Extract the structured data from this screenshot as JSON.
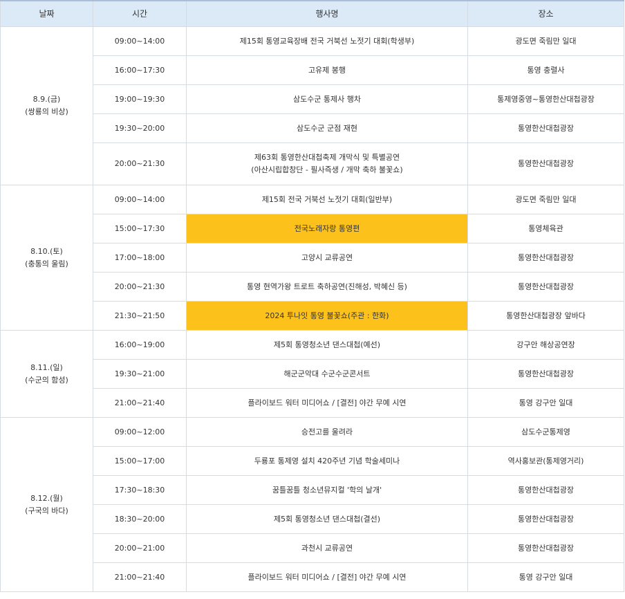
{
  "header": {
    "date": "날짜",
    "time": "시간",
    "event": "행사명",
    "place": "장소"
  },
  "highlight_color": "#fcc21b",
  "days": [
    {
      "date": "8.9.(금)",
      "subtitle": "(쌍룡의 비상)",
      "rows": [
        {
          "time": "09:00~14:00",
          "event": "제15회 통영교육장배 전국 거북선 노젓기 대회(학생부)",
          "place": "광도면 죽림만 일대"
        },
        {
          "time": "16:00~17:30",
          "event": "고유제 봉행",
          "place": "통영 충렬사"
        },
        {
          "time": "19:00~19:30",
          "event": "삼도수군 통제사 행차",
          "place": "통제영중영~통영한산대첩광장"
        },
        {
          "time": "19:30~20:00",
          "event": "삼도수군 군점 재현",
          "place": "통영한산대첩광장"
        },
        {
          "time": "20:00~21:30",
          "event": "제63회 통영한산대첩축제 개막식 및 특별공연",
          "event2": "(아산시립합창단 - 필사즉생 / 개막 축하 불꽃쇼)",
          "place": "통영한산대첩광장"
        }
      ]
    },
    {
      "date": "8.10.(토)",
      "subtitle": "(충통의 울림)",
      "rows": [
        {
          "time": "09:00~14:00",
          "event": "제15회 전국 거북선 노젓기 대회(일반부)",
          "place": "광도면 죽림만 일대"
        },
        {
          "time": "15:00~17:30",
          "event": "전국노래자랑 통영편",
          "place": "통영체육관"
        },
        {
          "time": "17:00~18:00",
          "event": "고양시 교류공연",
          "place": "통영한산대첩광장"
        },
        {
          "time": "20:00~21:30",
          "event": "통영 현역가왕 트로트 축하공연(진해성, 박혜신 등)",
          "place": "통영한산대첩광장"
        },
        {
          "time": "21:30~21:50",
          "event": "2024 투나잇 통영 불꽃쇼(주관 : 한화)",
          "place": "통영한산대첩광장 앞바다"
        }
      ]
    },
    {
      "date": "8.11.(일)",
      "subtitle": "(수군의 함성)",
      "rows": [
        {
          "time": "16:00~19:00",
          "event": "제5회 통영청소년 댄스대첩(예선)",
          "place": "강구안 해상공연장"
        },
        {
          "time": "19:30~21:00",
          "event": "해군군악대 수군수군콘서트",
          "place": "통영한산대첩광장"
        },
        {
          "time": "21:00~21:40",
          "event": "플라이보드 워터 미디어쇼 / [결전] 야간 무예 시연",
          "place": "통영 강구안 일대"
        }
      ]
    },
    {
      "date": "8.12.(월)",
      "subtitle": "(구국의 바다)",
      "rows": [
        {
          "time": "09:00~12:00",
          "event": "승전고를 울려라",
          "place": "삼도수군통제영"
        },
        {
          "time": "15:00~17:00",
          "event": "두룡포 통제영 설치 420주년 기념 학술세미나",
          "place": "역사홍보관(통제영거리)"
        },
        {
          "time": "17:30~18:30",
          "event": "꿈틀꿈틀 청소년뮤지컬 '학의 날개'",
          "place": "통영한산대첩광장"
        },
        {
          "time": "18:30~20:00",
          "event": "제5회 통영청소년 댄스대첩(결선)",
          "place": "통영한산대첩광장"
        },
        {
          "time": "20:00~21:00",
          "event": "과천시 교류공연",
          "place": "통영한산대첩광장"
        },
        {
          "time": "21:00~21:40",
          "event": "플라이보드 워터 미디어쇼 / [결전] 야간 무예 시연",
          "place": "통영 강구안 일대"
        }
      ]
    }
  ]
}
